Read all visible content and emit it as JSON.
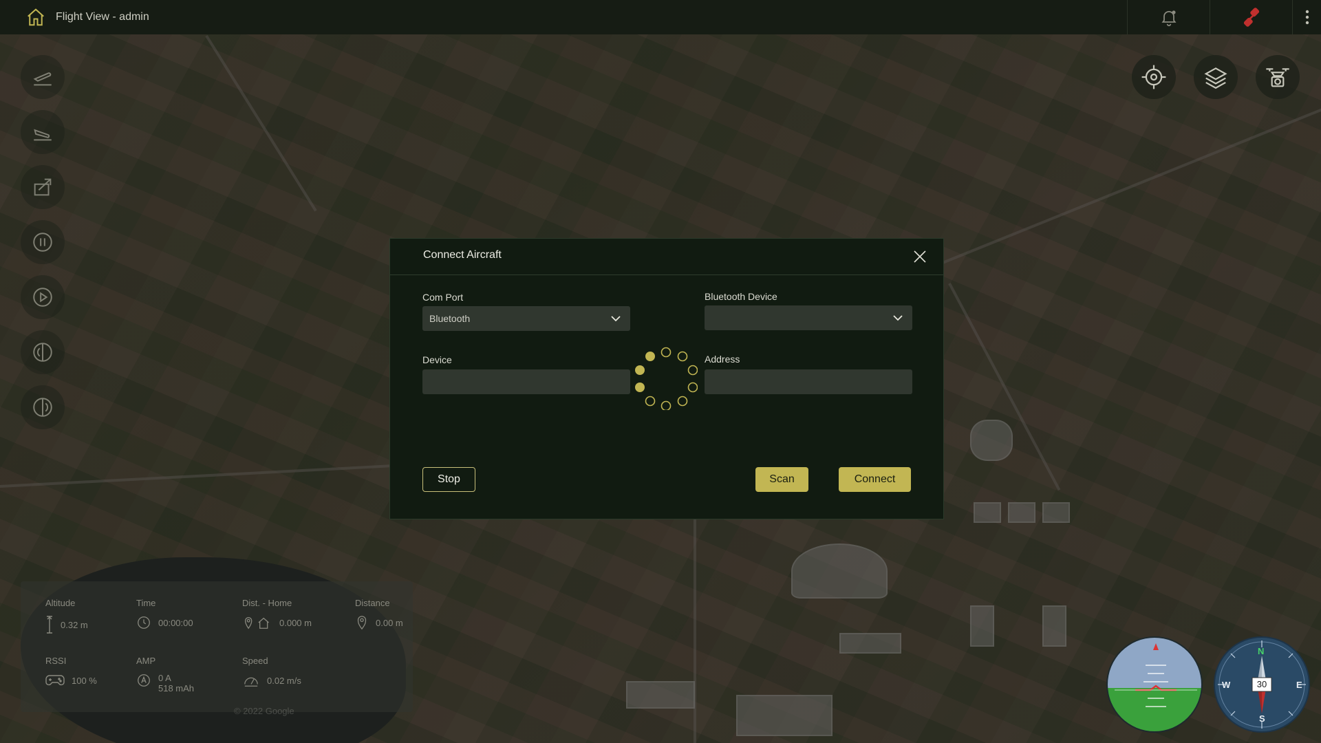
{
  "header": {
    "title": "Flight View - admin"
  },
  "icons": {
    "home": "home-icon",
    "notifications": "bell-icon",
    "connection": "disconnected-link-icon",
    "menu": "kebab-menu-icon",
    "locate": "crosshair-icon",
    "layers": "layers-icon",
    "drone_camera": "drone-camera-icon",
    "takeoff": "takeoff-icon",
    "land": "land-icon",
    "rtl": "return-to-launch-icon",
    "pause": "pause-icon",
    "play": "play-icon",
    "rotate_left": "rotate-left-icon",
    "rotate_right": "rotate-right-icon"
  },
  "telemetry": {
    "altitude": {
      "label": "Altitude",
      "value": "0.32 m"
    },
    "time": {
      "label": "Time",
      "value": "00:00:00"
    },
    "dist_home": {
      "label": "Dist. - Home",
      "value": "0.000 m"
    },
    "distance": {
      "label": "Distance",
      "value": "0.00 m"
    },
    "rssi": {
      "label": "RSSI",
      "value": "100 %"
    },
    "amp": {
      "label": "AMP",
      "value_a": "0 A",
      "value_mah": "518 mAh"
    },
    "speed": {
      "label": "Speed",
      "value": "0.02 m/s"
    }
  },
  "map": {
    "attribution": "© 2022 Google"
  },
  "compass": {
    "heading": "30",
    "n": "N",
    "e": "E",
    "s": "S",
    "w": "W"
  },
  "modal": {
    "title": "Connect Aircraft",
    "com_port": {
      "label": "Com Port",
      "value": "Bluetooth"
    },
    "bluetooth_device": {
      "label": "Bluetooth Device",
      "value": ""
    },
    "device": {
      "label": "Device",
      "value": ""
    },
    "address": {
      "label": "Address",
      "value": ""
    },
    "buttons": {
      "stop": "Stop",
      "scan": "Scan",
      "connect": "Connect"
    }
  },
  "colors": {
    "accent": "#c2b653",
    "modal_bg": "#111b11",
    "topbar_bg": "#161c14",
    "disconnected": "#c0302e"
  }
}
